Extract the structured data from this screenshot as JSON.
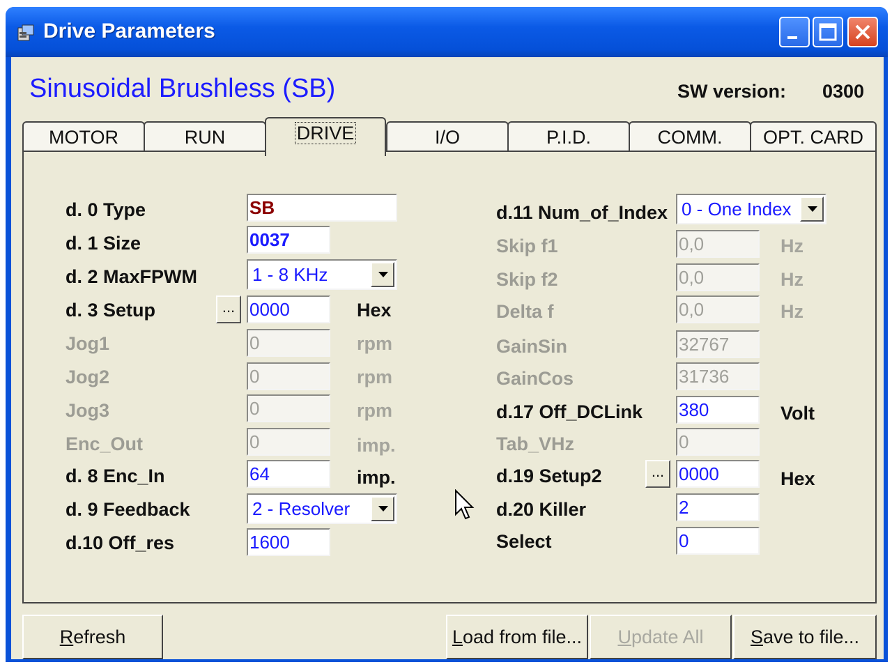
{
  "window": {
    "title": "Drive Parameters",
    "icons": [
      "app-icon",
      "minimize-icon",
      "maximize-icon",
      "close-icon"
    ]
  },
  "header": {
    "app_title": "Sinusoidal Brushless (SB)",
    "sw_label": "SW version:",
    "sw_value": "0300"
  },
  "tabs": [
    {
      "label": "MOTOR"
    },
    {
      "label": "RUN"
    },
    {
      "label": "DRIVE",
      "active": true
    },
    {
      "label": "I/O"
    },
    {
      "label": "P.I.D."
    },
    {
      "label": "COMM."
    },
    {
      "label": "OPT. CARD"
    }
  ],
  "left": [
    {
      "label": "d. 0 Type",
      "value": "SB"
    },
    {
      "label": "d. 1 Size",
      "value": "0037"
    },
    {
      "label": "d. 2 MaxFPWM",
      "value": "1 - 8 KHz"
    },
    {
      "label": "d. 3 Setup",
      "value": "0000",
      "unit": "Hex",
      "button": "..."
    },
    {
      "label": "Jog1",
      "value": "0",
      "unit": "rpm"
    },
    {
      "label": "Jog2",
      "value": "0",
      "unit": "rpm"
    },
    {
      "label": "Jog3",
      "value": "0",
      "unit": "rpm"
    },
    {
      "label": "Enc_Out",
      "value": "0",
      "unit": "imp."
    },
    {
      "label": "d. 8 Enc_In",
      "value": "64",
      "unit": "imp."
    },
    {
      "label": "d. 9 Feedback",
      "value": "2 - Resolver"
    },
    {
      "label": "d.10 Off_res",
      "value": "1600"
    }
  ],
  "right": [
    {
      "label": "d.11 Num_of_Index",
      "value": "0 - One Index"
    },
    {
      "label": "Skip f1",
      "value": "0,0",
      "unit": "Hz"
    },
    {
      "label": "Skip f2",
      "value": "0,0",
      "unit": "Hz"
    },
    {
      "label": "Delta f",
      "value": "0,0",
      "unit": "Hz"
    },
    {
      "label": "GainSin",
      "value": "32767"
    },
    {
      "label": "GainCos",
      "value": "31736"
    },
    {
      "label": "d.17 Off_DCLink",
      "value": "380",
      "unit": "Volt"
    },
    {
      "label": "Tab_VHz",
      "value": "0"
    },
    {
      "label": "d.19 Setup2",
      "value": "0000",
      "unit": "Hex",
      "button": "..."
    },
    {
      "label": "d.20 Killer",
      "value": "2"
    },
    {
      "label": "Select",
      "value": "0"
    }
  ],
  "buttons": {
    "refresh_first": "R",
    "refresh_rest": "efresh",
    "load_first": "L",
    "load_rest": "oad from file...",
    "update_first": "U",
    "update_rest": "pdate All",
    "save_first": "S",
    "save_rest": "ave to file..."
  }
}
